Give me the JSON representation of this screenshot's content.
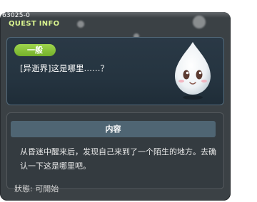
{
  "quest_id": "63025-0",
  "window": {
    "title": "QUEST INFO"
  },
  "quest": {
    "category": "一般",
    "name": "[异逝界]这是哪里……？"
  },
  "content": {
    "header": "内容",
    "description": "从昏迷中醒来后，发现自己来到了一个陌生的地方。去确认一下这是哪里吧。"
  },
  "status": {
    "text": "狀態: 可開始"
  },
  "colors": {
    "window_bg": "#3b4145",
    "title_accent": "#d8f28e",
    "badge_green": "#8cc63f",
    "content_header_bg": "#4f6573"
  },
  "icons": {
    "mascot": "white-spirit-mascot-icon"
  }
}
